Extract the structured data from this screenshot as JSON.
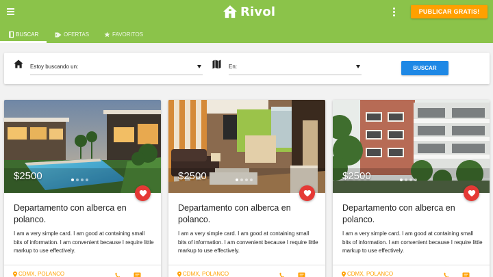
{
  "app": {
    "title": "Rivol",
    "publish_label": "PUBLICAR GRATIS!"
  },
  "tabs": [
    {
      "label": "BUSCAR",
      "icon": "book-icon",
      "active": true
    },
    {
      "label": "OFERTAS",
      "icon": "tag-icon",
      "active": false
    },
    {
      "label": "FAVORITOS",
      "icon": "star-icon",
      "active": false
    }
  ],
  "search": {
    "property_label": "Estoy buscando un:",
    "location_label": "En:",
    "button_label": "BUSCAR"
  },
  "colors": {
    "primary": "#8bc34a",
    "accent": "#ffa000",
    "button": "#1e88e5",
    "favorite": "#e53935"
  },
  "listings": [
    {
      "price": "$2500",
      "title": "Departamento con alberca en polanco.",
      "description": "I am a very simple card. I am good at containing small bits of information. I am convenient because I require little markup to use effectively.",
      "location": "CDMX, POLANCO",
      "image": "pool-villa-photo"
    },
    {
      "price": "$2500",
      "title": "Departamento con alberca en polanco.",
      "description": "I am a very simple card. I am good at containing small bits of information. I am convenient because I require little markup to use effectively.",
      "location": "CDMX, POLANCO",
      "image": "apartment-interior-photo"
    },
    {
      "price": "$2500",
      "title": "Departamento con alberca en polanco.",
      "description": "I am a very simple card. I am good at containing small bits of information. I am convenient because I require little markup to use effectively.",
      "location": "CDMX, POLANCO",
      "image": "apartment-building-photo"
    }
  ]
}
